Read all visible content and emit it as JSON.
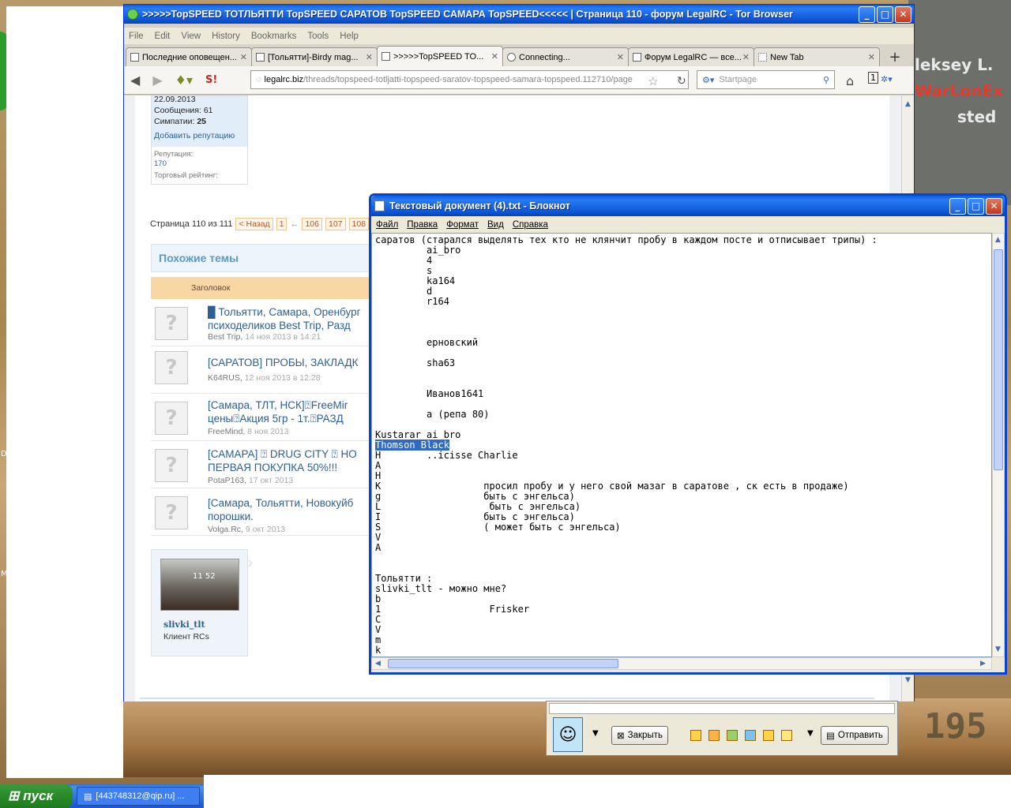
{
  "desktop": {
    "side_lines": [
      "leksey L.",
      "WarLonEx",
      "sted"
    ],
    "left_chars": [
      "D",
      "M"
    ],
    "hud": "195"
  },
  "browser": {
    "title": ">>>>>TopSPEED ТОТЛЬЯТТИ TopSPEED САРАТОВ TopSPEED САМАРА TopSPEED<<<<< | Страница 110 - форум LegalRC - Tor Browser",
    "menu": [
      "File",
      "Edit",
      "View",
      "History",
      "Bookmarks",
      "Tools",
      "Help"
    ],
    "tabs": [
      {
        "label": "Последние оповещен..."
      },
      {
        "label": "[Тольятти]-Birdy mag..."
      },
      {
        "label": ">>>>>TopSPEED TO..."
      },
      {
        "label": "Connecting..."
      },
      {
        "label": "Форум LegalRC — все..."
      },
      {
        "label": "New Tab"
      }
    ],
    "url_host": "legalrc.biz",
    "url_path": "/threads/topspeed-totljatti-topspeed-saratov-topspeed-samara-topspeed.112710/page",
    "search_placeholder": "Startpage",
    "tor_badge": "1"
  },
  "forum": {
    "user_lines": [
      "22.09.2013",
      "Сообщения: 61",
      "Симпатии:",
      "25",
      "Добавить репутацию",
      "Репутация:",
      "170",
      "Торговый рейтинг:"
    ],
    "pager": {
      "label": "Страница 110 из 111",
      "prev": "< Назад",
      "pages": [
        "1",
        "106",
        "107",
        "108"
      ],
      "sep": "←"
    },
    "similar_title": "Похожие темы",
    "table_header": "Заголовок",
    "threads": [
      {
        "title1": "█ Тольятти, Самара, Оренбург",
        "title2": "психоделиков Best Trip, Разд",
        "author": "Best Trip",
        "date": "14 ноя 2013 в 14:21"
      },
      {
        "title1": "[САРАТОВ] ПРОБЫ, ЗАКЛАДК",
        "title2": "",
        "author": "K64RUS",
        "date": "12 ноя 2013 в 12:28"
      },
      {
        "title1": "[Самара, ТЛТ, НСК]⍰FreeMir",
        "title2": "цены⍰Акция 5гр - 1т.⍰РАЗД",
        "author": "FreeMind",
        "date": "8 ноя 2013"
      },
      {
        "title1": "[САМАРА] ⍰ DRUG CITY ⍰ НО",
        "title2": "ПЕРВАЯ ПОКУПКА 50%!!!",
        "author": "PotaP163",
        "date": "17 окт 2013"
      },
      {
        "title1": "[Самара, Тольятти, Новокуйб",
        "title2": "порошки.",
        "author": "Volga.Rc",
        "date": "9 окт 2013"
      }
    ],
    "profile": {
      "name": "slivki_tlt",
      "role": "Клиент RCs",
      "photo_text": "11 52"
    }
  },
  "notepad": {
    "title": "Текстовый документ (4).txt - Блокнот",
    "menu": [
      "Файл",
      "Правка",
      "Формат",
      "Вид",
      "Справка"
    ],
    "lines_before": "саратов (старался выделять тех кто не клянчит пробу в каждом посте и отписывает трипы) :\n         ai_bro\n         4\n         s\n         ka164\n         d\n         r164\n\n\n\n         ерновский\n\n         sha63\n\n\n         Иванов1641\n\n         а (репа 80)\n\nKustarar ai_bro",
    "selected": "Thomson Black",
    "lines_after": "\nH        ..icisse Charlie\nA\nH\nK                  просил пробу и у него свой мазаг в саратове , ск есть в продаже)\ng                  быть с энгельса)\nL                   быть с энгельса)\nI                  быть с энгельса)\nS                  ( может быть с энгельса)\nV\nA\n\n\nТольятти :\nslivki_tlt - можно мне?\nb\n1                   Frisker\nC\nV\nm\nk"
  },
  "chat": {
    "close_label": "Закрыть",
    "send_label": "Отправить"
  },
  "taskbar": {
    "start_label": "пуск",
    "task_label": "[443748312@qip.ru] ..."
  }
}
